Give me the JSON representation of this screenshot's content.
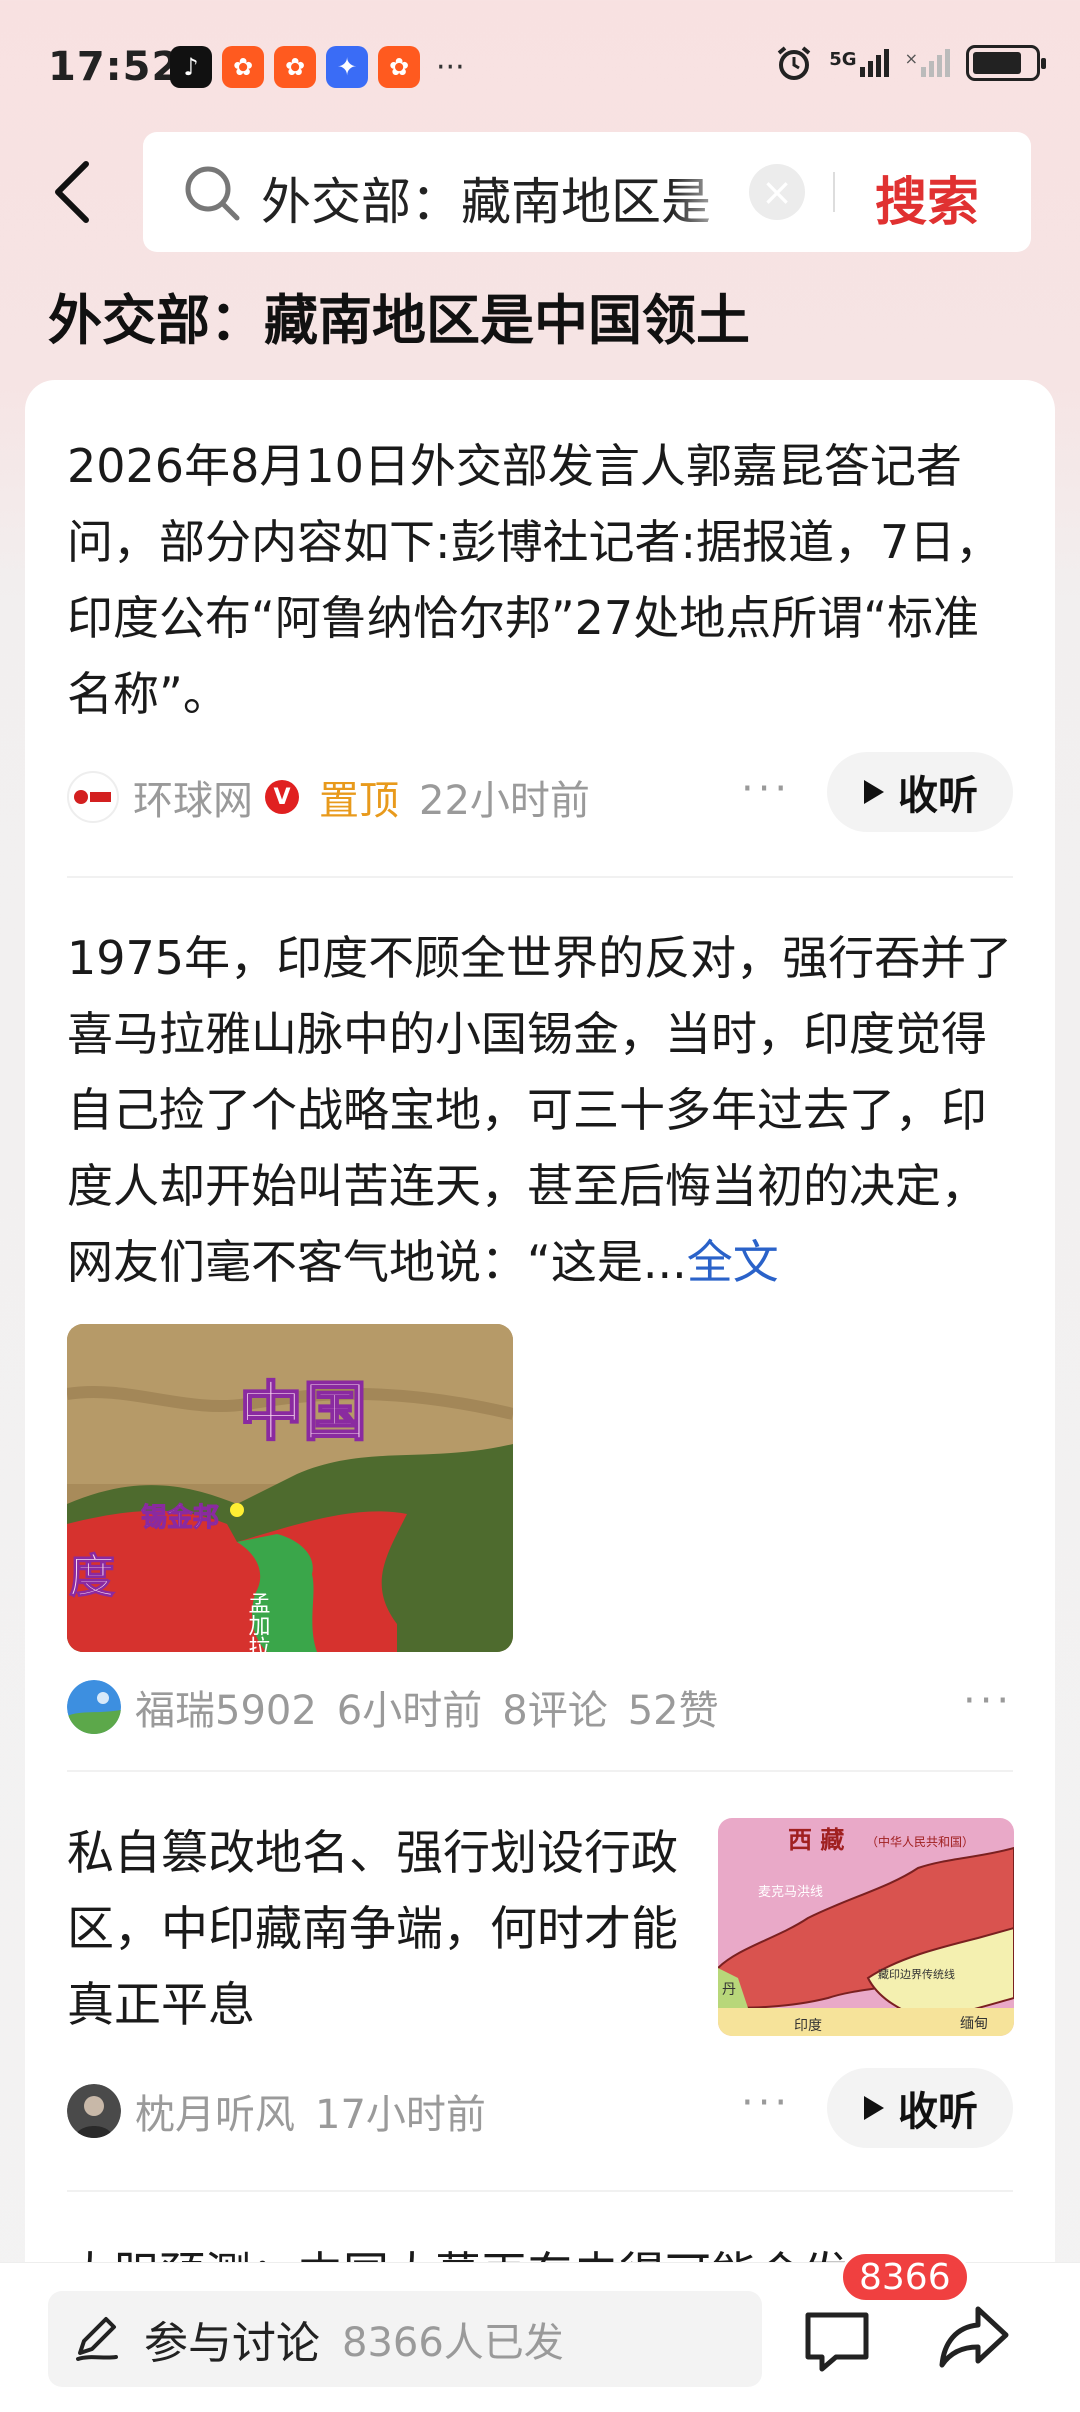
{
  "status_bar": {
    "time": "17:52",
    "network": "5G"
  },
  "search": {
    "query": "外交部：藏南地区是",
    "search_button": "搜索"
  },
  "page_title": "外交部：藏南地区是中国领土",
  "feed": [
    {
      "text": "2026年8月10日外交部发言人郭嘉昆答记者问，部分内容如下:彭博社记者:据报道，7日，印度公布“阿鲁纳恰尔邦”27处地点所谓“标准名称”。",
      "source": "环球网",
      "verified": "V",
      "pinned": "置顶",
      "time": "22小时前",
      "listen": "收听"
    },
    {
      "text": "1975年，印度不顾全世界的反对，强行吞并了喜马拉雅山脉中的小国锡金，当时，印度觉得自己捡了个战略宝地，可三十多年过去了，印度人却开始叫苦连天，甚至后悔当初的决定，网友们毫不客气地说：“这是...",
      "more": "全文",
      "image": {
        "label_china": "中国",
        "label_sikkim": "锡金邦",
        "label_india": "度",
        "label_bangla": "孟加拉"
      },
      "author": "福瑞5902",
      "time": "6小时前",
      "comments": "8评论",
      "likes": "52赞"
    },
    {
      "text": "私自篡改地名、强行划设行政区，中印藏南争端，何时才能真正平息",
      "image": {
        "label_tibet": "西 藏",
        "label_prc": "（中华人民共和国）",
        "label_mcmahon": "麦克马洪线",
        "label_border": "藏印边界传统线",
        "label_india": "印度",
        "label_burma": "缅甸",
        "label_bhutan": "丹"
      },
      "author": "枕月听风",
      "time": "17小时前",
      "listen": "收听"
    }
  ],
  "peek_text": "大胆预测：中国大幕再东去得可能会发生大",
  "bottom_bar": {
    "discuss_label": "参与讨论",
    "discuss_count": "8366人已发",
    "comment_badge": "8366"
  }
}
